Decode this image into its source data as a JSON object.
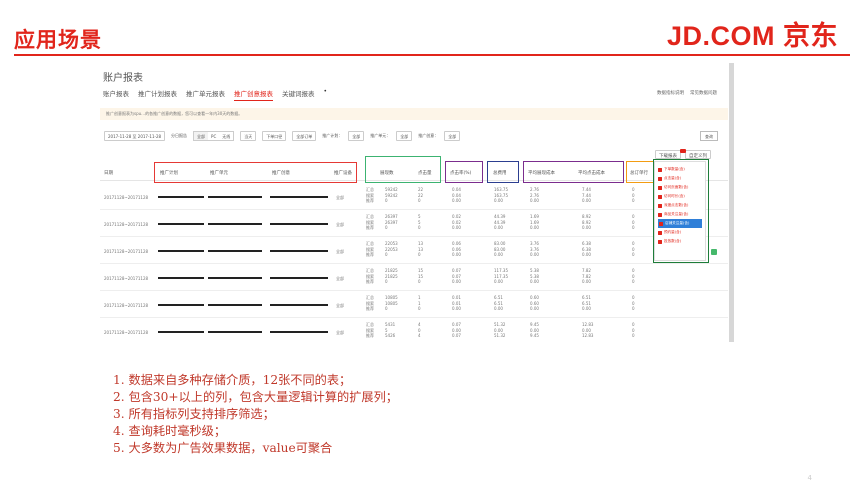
{
  "slide": {
    "title": "应用场景",
    "brand": "JD.COM 京东",
    "page_number": "4"
  },
  "screenshot": {
    "title": "账户报表",
    "tabs": [
      {
        "label": "账户报表",
        "active": false
      },
      {
        "label": "推广计划报表",
        "active": false
      },
      {
        "label": "推广单元报表",
        "active": false
      },
      {
        "label": "推广创意报表",
        "active": true
      },
      {
        "label": "关键词报表",
        "active": false
      }
    ],
    "tab_extra": "•",
    "top_links": [
      "数据指标说明",
      "常见数据问题"
    ],
    "notice": "推广创意报表为spu…的各推广创意的数据，您可以查看一年内30天的数据。",
    "filters": {
      "date_range": "2017-11-28 至 2017-11-28",
      "compare_label": "分日报告",
      "platform_options": [
        "全部",
        "PC",
        "无线"
      ],
      "time_select": "当天",
      "order_select": "下单口径",
      "order_type_select": "全部订单",
      "plan_label": "推广计划：",
      "plan_value": "全部",
      "unit_label": "推广单元：",
      "unit_value": "全部",
      "creative_label": "推广创意：",
      "creative_value": "全部",
      "query_button": "查询"
    },
    "toolbar": {
      "download": "下载报表",
      "custom_columns": "自定义列"
    },
    "columns": [
      "日期",
      "推广计划",
      "推广单元",
      "推广创意",
      "推广设备",
      "展现数",
      "点击量",
      "点击率(%)",
      "总费用",
      "平均展现成本",
      "平均点击成本",
      "总订单行"
    ],
    "row_sub_labels": [
      "汇总",
      "搜索",
      "推荐"
    ],
    "rows": [
      {
        "date": "20171128~20171128",
        "device": "全部",
        "impressions": [
          "59242",
          "59242",
          "0"
        ],
        "clicks": [
          "22",
          "22",
          "0"
        ],
        "ctr": [
          "0.04",
          "0.04",
          "0.00"
        ],
        "cost": [
          "163.75",
          "163.75",
          "0.00"
        ],
        "avg_imp_cost": [
          "2.76",
          "2.76",
          "0.00"
        ],
        "avg_click_cost": [
          "7.44",
          "7.44",
          "0.00"
        ],
        "orders": [
          "0",
          "0",
          "0"
        ]
      },
      {
        "date": "20171128~20171128",
        "device": "全部",
        "impressions": [
          "26397",
          "26397",
          "0"
        ],
        "clicks": [
          "5",
          "5",
          "0"
        ],
        "ctr": [
          "0.02",
          "0.02",
          "0.00"
        ],
        "cost": [
          "44.39",
          "44.39",
          "0.00"
        ],
        "avg_imp_cost": [
          "1.69",
          "1.69",
          "0.00"
        ],
        "avg_click_cost": [
          "8.92",
          "8.92",
          "0.00"
        ],
        "orders": [
          "0",
          "0",
          "0"
        ]
      },
      {
        "date": "20171128~20171128",
        "device": "全部",
        "impressions": [
          "22053",
          "22053",
          "0"
        ],
        "clicks": [
          "13",
          "13",
          "0"
        ],
        "ctr": [
          "0.06",
          "0.06",
          "0.00"
        ],
        "cost": [
          "83.00",
          "83.00",
          "0.00"
        ],
        "avg_imp_cost": [
          "3.76",
          "3.76",
          "0.00"
        ],
        "avg_click_cost": [
          "6.38",
          "6.38",
          "0.00"
        ],
        "orders": [
          "0",
          "0",
          "0"
        ]
      },
      {
        "date": "20171128~20171128",
        "device": "全部",
        "impressions": [
          "21825",
          "21825",
          "0"
        ],
        "clicks": [
          "15",
          "15",
          "0"
        ],
        "ctr": [
          "0.07",
          "0.07",
          "0.00"
        ],
        "cost": [
          "117.35",
          "117.35",
          "0.00"
        ],
        "avg_imp_cost": [
          "5.38",
          "5.38",
          "0.00"
        ],
        "avg_click_cost": [
          "7.82",
          "7.82",
          "0.00"
        ],
        "orders": [
          "0",
          "0",
          "0"
        ]
      },
      {
        "date": "20171128~20171128",
        "device": "全部",
        "impressions": [
          "10805",
          "10805",
          "0"
        ],
        "clicks": [
          "1",
          "1",
          "0"
        ],
        "ctr": [
          "0.01",
          "0.01",
          "0.00"
        ],
        "cost": [
          "6.51",
          "6.51",
          "0.00"
        ],
        "avg_imp_cost": [
          "0.60",
          "0.60",
          "0.00"
        ],
        "avg_click_cost": [
          "6.51",
          "6.51",
          "0.00"
        ],
        "orders": [
          "0",
          "0",
          "0"
        ]
      },
      {
        "date": "20171128~20171128",
        "device": "全部",
        "impressions": [
          "5431",
          "5",
          "5426"
        ],
        "clicks": [
          "4",
          "0",
          "4"
        ],
        "ctr": [
          "0.07",
          "0.00",
          "0.07"
        ],
        "cost": [
          "51.32",
          "0.00",
          "51.32"
        ],
        "avg_imp_cost": [
          "9.45",
          "0.00",
          "9.45"
        ],
        "avg_click_cost": [
          "12.83",
          "0.00",
          "12.83"
        ],
        "orders": [
          "0",
          "0",
          "0"
        ]
      }
    ],
    "column_menu": [
      "下单数量(含)",
      "点击量(含)",
      "访问页面数(含)",
      "访问时长(含)",
      "深度点击数(含)",
      "商品关注量(含)",
      "店铺关注量(含)",
      "预约量(含)",
      "投放数(含)"
    ],
    "column_menu_selected_index": 6
  },
  "bullets": [
    "1. 数据来自多种存储介质，12张不同的表；",
    "2. 包含30+以上的列，包含大量逻辑计算的扩展列；",
    "3. 所有指标列支持排序筛选；",
    "4. 查询耗时毫秒级；",
    "5. 大多数为广告效果数据，value可聚合"
  ],
  "colors": {
    "brand_red": "#e1251b",
    "highlight_red": "#e53935",
    "highlight_green": "#3cb371",
    "highlight_purple": "#7b2d8e",
    "highlight_navy": "#2c3e90",
    "highlight_orange": "#f39c12",
    "highlight_darkgreen": "#1e7d3a"
  }
}
